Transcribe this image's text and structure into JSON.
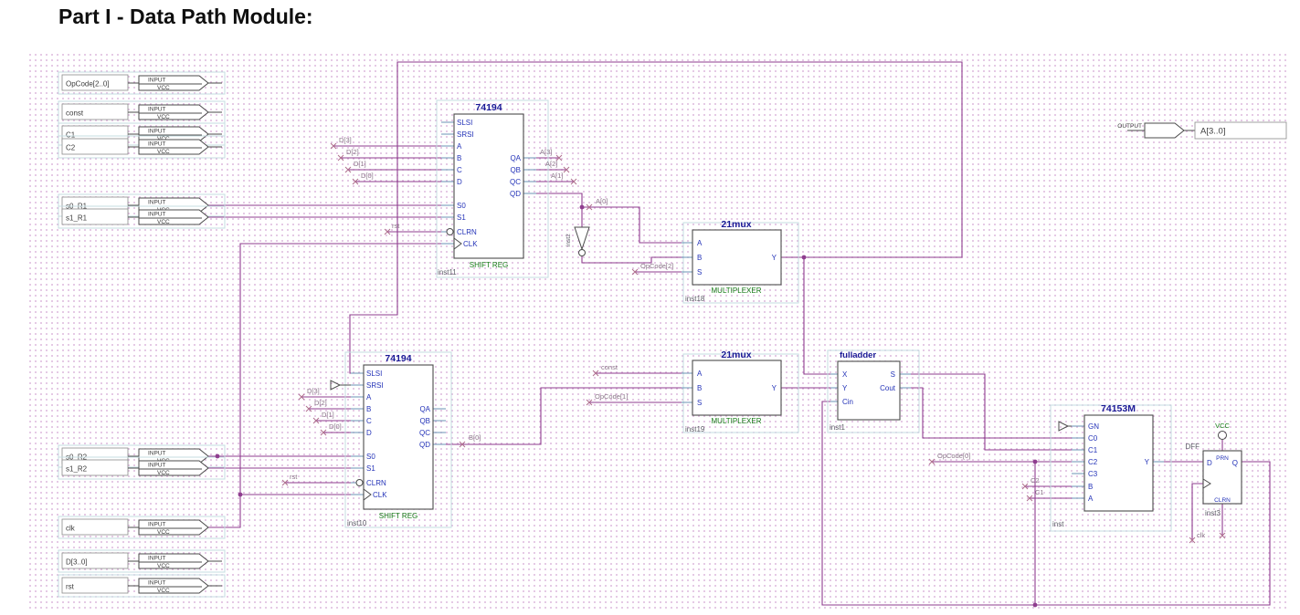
{
  "title": "Part I - Data Path Module:",
  "shift_pins": {
    "slsi": "SLSI",
    "srsi": "SRSI",
    "a": "A",
    "b": "B",
    "c": "C",
    "d": "D",
    "s0": "S0",
    "s1": "S1",
    "clrn": "CLRN",
    "clk": "CLK",
    "qa": "QA",
    "qb": "QB",
    "qc": "QC",
    "qd": "QD"
  },
  "mux_pins": {
    "a": "A",
    "b": "B",
    "s": "S",
    "y": "Y"
  },
  "shift1": {
    "title": "74194",
    "category": "SHIFT REG",
    "instance": "inst11"
  },
  "shift2": {
    "title": "74194",
    "category": "SHIFT REG",
    "instance": "inst10"
  },
  "mux1": {
    "title": "21mux",
    "category": "MULTIPLEXER",
    "instance": "inst18"
  },
  "mux2": {
    "title": "21mux",
    "category": "MULTIPLEXER",
    "instance": "inst19"
  },
  "adder": {
    "title": "fulladder",
    "instance": "inst1",
    "pins": {
      "x": "X",
      "y": "Y",
      "cin": "Cin",
      "s": "S",
      "cout": "Cout"
    }
  },
  "mux4": {
    "title": "74153M",
    "instance": "inst",
    "pins": {
      "gn": "GN",
      "c0": "C0",
      "c1": "C1",
      "c2": "C2",
      "c3": "C3",
      "b": "B",
      "a": "A",
      "y": "Y"
    }
  },
  "dff": {
    "label": "DFF",
    "instance": "inst3",
    "vcc": "VCC",
    "pins": {
      "prn": "PRN",
      "clrn": "CLRN",
      "d": "D",
      "q": "Q"
    }
  },
  "inverter": {
    "instance": "inst2"
  },
  "io": {
    "input_label": "INPUT",
    "vcc_label": "VCC",
    "output_label": "OUTPUT",
    "inputs": [
      "OpCode[2..0]",
      "const",
      "C1",
      "C2",
      "s0_R1",
      "s1_R1",
      "s0_R2",
      "s1_R2",
      "clk",
      "D[3..0]",
      "rst"
    ],
    "output_name": "A[3..0]"
  },
  "nets": {
    "d3": "D[3]",
    "d2": "D[2]",
    "d1": "D[1]",
    "d0": "D[0]",
    "a3": "A[3]",
    "a2": "A[2]",
    "a1": "A[1]",
    "a0": "A[0]",
    "b0": "B[0]",
    "rst": "rst",
    "const": "const",
    "clk": "clk",
    "op2": "OpCode[2]",
    "op1": "OpCode[1]",
    "op0": "OpCode[0]",
    "c2": "C2",
    "c1": "C1"
  }
}
